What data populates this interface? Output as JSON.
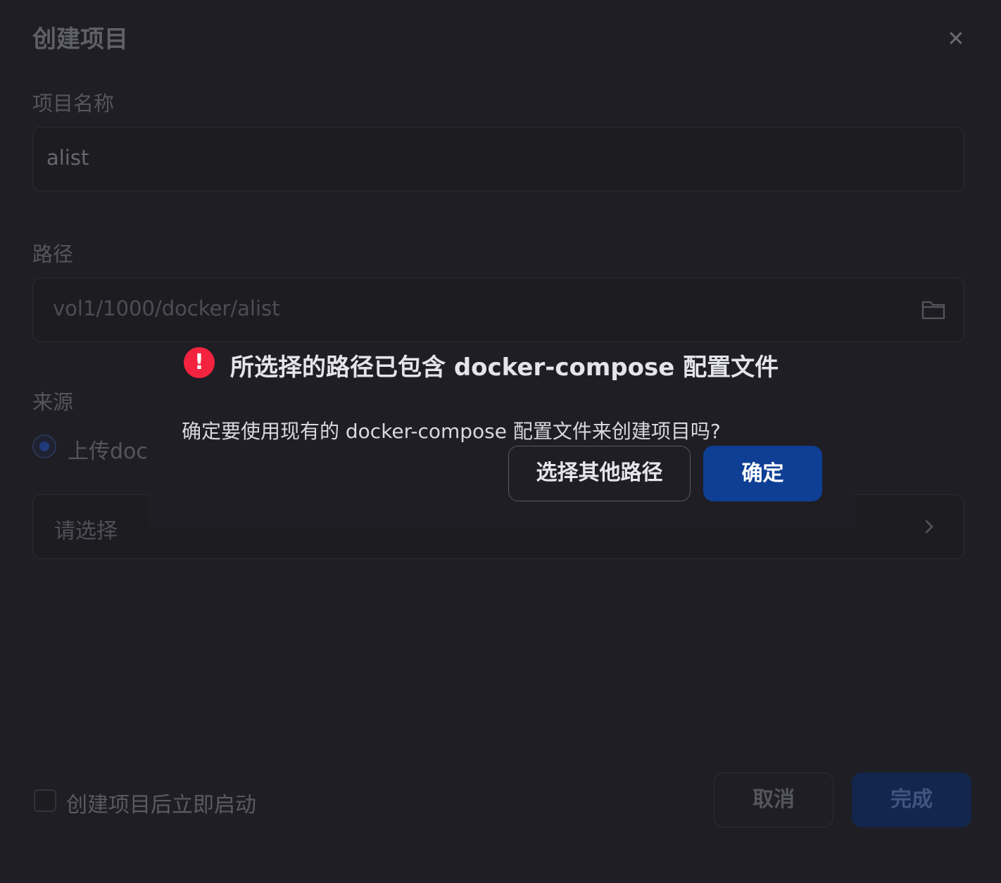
{
  "dialog": {
    "title": "创建项目",
    "close_icon": "close-icon"
  },
  "form": {
    "name_label": "项目名称",
    "name_value": "alist",
    "path_label": "路径",
    "path_value": "vol1/1000/docker/alist",
    "path_icon": "folder-icon",
    "source_label": "来源",
    "source_option": "上传doc",
    "select_placeholder": "请选择",
    "select_icon": "chevron-right-icon",
    "autostart_label": "创建项目后立即启动",
    "autostart_checked": false
  },
  "footer": {
    "cancel_label": "取消",
    "finish_label": "完成"
  },
  "popover": {
    "icon": "exclamation-icon",
    "icon_glyph": "!",
    "title": "所选择的路径已包含 docker-compose 配置文件",
    "message": "确定要使用现有的 docker-compose 配置文件来创建项目吗?",
    "other_path_label": "选择其他路径",
    "confirm_label": "确定"
  },
  "colors": {
    "accent": "#0f3f94",
    "warning": "#f3233f"
  }
}
